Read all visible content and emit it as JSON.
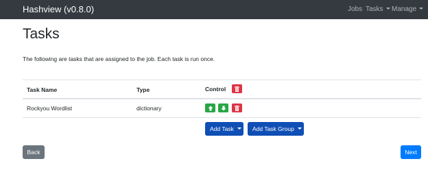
{
  "navbar": {
    "brand": "Hashview (v0.8.0)",
    "links": [
      "Jobs",
      "Tasks",
      "Manage"
    ],
    "background": "#343a40"
  },
  "page": {
    "title": "Tasks",
    "intro": "The following are tasks that are assigned to the job. Each task is run once."
  },
  "table": {
    "headers": [
      "Task Name",
      "Type",
      "Control"
    ],
    "rows": [
      {
        "name": "Rockyou Wordlist",
        "type": "dictionary"
      }
    ]
  },
  "actions": {
    "add_task": "Add Task",
    "add_task_group": "Add Task Group",
    "back": "Back",
    "next": "Next"
  },
  "icons": {
    "move_up": "arrow-up-icon",
    "move_down": "arrow-down-icon",
    "delete": "trash-icon",
    "dropdown": "caret-down-icon"
  },
  "colors": {
    "success": "#28a745",
    "danger": "#dc3545",
    "primary_dropdown": "#0f4fb5",
    "primary": "#007bff",
    "secondary": "#6c757d"
  }
}
